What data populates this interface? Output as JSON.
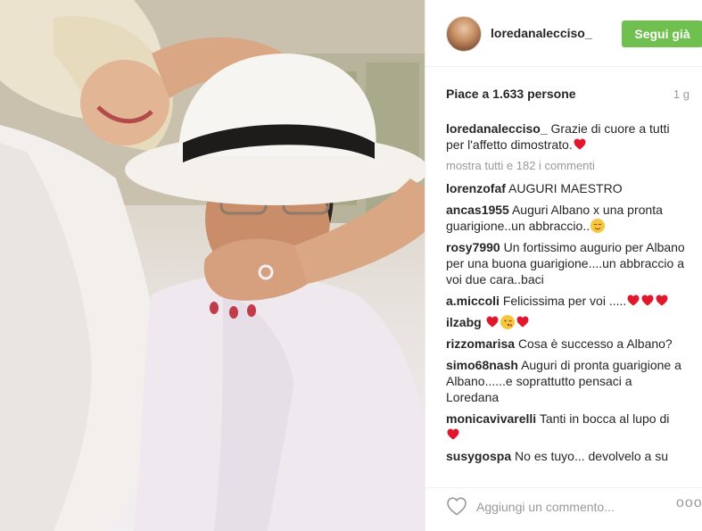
{
  "post": {
    "username": "loredanalecciso_",
    "follow_label": "Segui già",
    "likes_text": "Piace a 1.633 persone",
    "time_ago": "1 g",
    "show_all": "mostra tutti e 182 i commenti",
    "add_comment_placeholder": "Aggiungi un commento...",
    "more_options": "ooo"
  },
  "comments": [
    {
      "user": "loredanalecciso_",
      "text": "Grazie di cuore a tutti per l'affetto dimostrato."
    },
    {
      "user": "lorenzofaf",
      "text": "AUGURI MAESTRO"
    },
    {
      "user": "ancas1955",
      "text": "Auguri Albano x una pronta guarigione..un abbraccio.."
    },
    {
      "user": "rosy7990",
      "text": "Un fortissimo augurio per Albano per una buona guarigione....un abbraccio a voi due cara..baci"
    },
    {
      "user": "a.miccoli",
      "text": "Felicissima per voi ....."
    },
    {
      "user": "ilzabg",
      "text": ""
    },
    {
      "user": "rizzomarisa",
      "text": "Cosa è successo a Albano?"
    },
    {
      "user": "simo68nash",
      "text": "Auguri di pronta guarigione a Albano......e soprattutto pensaci a Loredana"
    },
    {
      "user": "monicavivarelli",
      "text": "Tanti in bocca al lupo di"
    },
    {
      "user": "susygospa",
      "text": "No es tuyo... devolvelo a su"
    }
  ],
  "colors": {
    "follow_button": "#70c050",
    "heart_red": "#e0182d",
    "muted_text": "#999999"
  },
  "icons": [
    "heart-icon",
    "ellipsis-icon",
    "heart-emoji",
    "blushing-face-emoji",
    "kissing-face-emoji"
  ]
}
